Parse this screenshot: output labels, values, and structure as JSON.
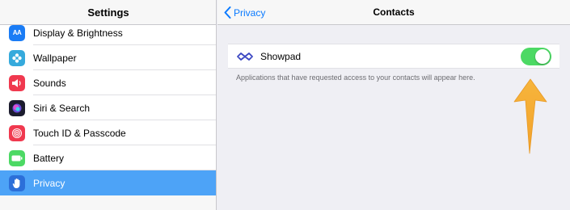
{
  "settings": {
    "title": "Settings",
    "items": [
      {
        "label": "Display & Brightness",
        "icon": "display-brightness-icon",
        "color": "#1a7cf5",
        "glyph": "AA"
      },
      {
        "label": "Wallpaper",
        "icon": "wallpaper-icon",
        "color": "#36aadc",
        "glyph": "✿"
      },
      {
        "label": "Sounds",
        "icon": "sounds-icon",
        "color": "#f0394f",
        "glyph": "🔊"
      },
      {
        "label": "Siri & Search",
        "icon": "siri-icon",
        "color": "#2b2b2b",
        "glyph": "◉"
      },
      {
        "label": "Touch ID & Passcode",
        "icon": "fingerprint-icon",
        "color": "#f0394f",
        "glyph": "⊚"
      },
      {
        "label": "Battery",
        "icon": "battery-icon",
        "color": "#4cd964",
        "glyph": "▬"
      },
      {
        "label": "Privacy",
        "icon": "hand-icon",
        "color": "#2c6fd9",
        "glyph": "✋",
        "selected": true
      }
    ]
  },
  "detail": {
    "back_label": "Privacy",
    "title": "Contacts",
    "app": {
      "name": "Showpad",
      "toggle_on": true,
      "icon": "showpad-icon"
    },
    "footer": "Applications that have requested access to your contacts will appear here."
  },
  "colors": {
    "accent": "#0a7aff",
    "selected_row": "#4da3f7",
    "toggle_on": "#4cd964",
    "arrow": "#f5b03a"
  }
}
